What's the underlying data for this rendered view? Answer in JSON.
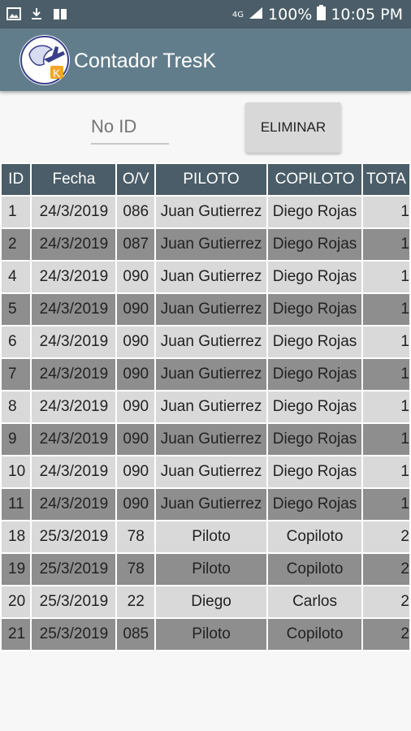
{
  "status_bar": {
    "network": "4G",
    "battery": "100%",
    "time": "10:05 PM"
  },
  "app": {
    "title": "Contador TresK"
  },
  "form": {
    "id_placeholder": "No ID",
    "delete_button": "ELIMINAR"
  },
  "table": {
    "headers": [
      "ID",
      "Fecha",
      "O/V",
      "PILOTO",
      "COPILOTO",
      "TOTA"
    ],
    "rows": [
      [
        "1",
        "24/3/2019",
        "086",
        "Juan Gutierrez",
        "Diego Rojas",
        "1"
      ],
      [
        "2",
        "24/3/2019",
        "087",
        "Juan Gutierrez",
        "Diego Rojas",
        "1"
      ],
      [
        "4",
        "24/3/2019",
        "090",
        "Juan Gutierrez",
        "Diego Rojas",
        "1"
      ],
      [
        "5",
        "24/3/2019",
        "090",
        "Juan Gutierrez",
        "Diego Rojas",
        "1"
      ],
      [
        "6",
        "24/3/2019",
        "090",
        "Juan Gutierrez",
        "Diego Rojas",
        "1"
      ],
      [
        "7",
        "24/3/2019",
        "090",
        "Juan Gutierrez",
        "Diego Rojas",
        "1"
      ],
      [
        "8",
        "24/3/2019",
        "090",
        "Juan Gutierrez",
        "Diego Rojas",
        "1"
      ],
      [
        "9",
        "24/3/2019",
        "090",
        "Juan Gutierrez",
        "Diego Rojas",
        "1"
      ],
      [
        "10",
        "24/3/2019",
        "090",
        "Juan Gutierrez",
        "Diego Rojas",
        "1"
      ],
      [
        "11",
        "24/3/2019",
        "090",
        "Juan Gutierrez",
        "Diego Rojas",
        "1"
      ],
      [
        "18",
        "25/3/2019",
        "78",
        "Piloto",
        "Copiloto",
        "2"
      ],
      [
        "19",
        "25/3/2019",
        "78",
        "Piloto",
        "Copiloto",
        "2"
      ],
      [
        "20",
        "25/3/2019",
        "22",
        "Diego",
        "Carlos",
        "2"
      ],
      [
        "21",
        "25/3/2019",
        "085",
        "Piloto",
        "Copiloto",
        "2"
      ]
    ]
  },
  "colors": {
    "status_bar": "#4a5d68",
    "app_bar": "#617d8b",
    "header": "#4a5d68",
    "row_light": "#d9d9d9",
    "row_dark": "#8e8e8e"
  }
}
